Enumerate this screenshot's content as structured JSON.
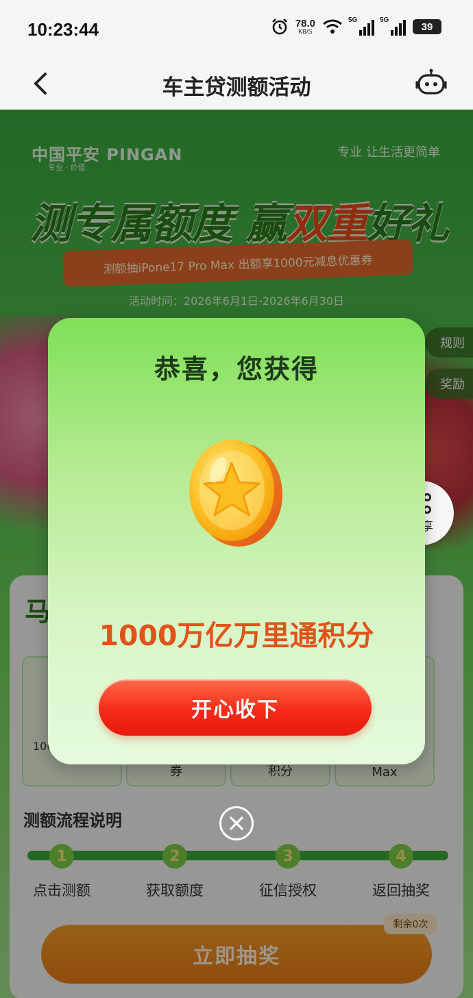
{
  "status_bar": {
    "time": "10:23:44",
    "net_speed_value": "78.0",
    "net_speed_unit": "KB/S",
    "signal1_label": "5G",
    "signal2_label": "5G",
    "battery": "39"
  },
  "nav": {
    "title": "车主贷测额活动",
    "icons": {
      "back": "chevron-left-icon",
      "service": "robot-service-icon"
    }
  },
  "background": {
    "brand": "中国平安 PINGAN",
    "brand_sub": "专业 · 价值",
    "slogan": "专业 让生活更简单",
    "headline_a": "测专属额度 赢",
    "headline_b": "双重",
    "headline_c": "好礼",
    "ribbon": "测额抽iPone17 Pro Max  出额享1000元减息优惠券",
    "period": "活动时间：2026年6月1日-2026年6月30日",
    "side_rule": "规则",
    "side_reward": "奖励",
    "card_head": "马",
    "prizes": [
      {
        "top": "100",
        "caption": ""
      },
      {
        "top": "",
        "caption": "券"
      },
      {
        "top": "",
        "caption": "积分"
      },
      {
        "top": "o",
        "caption": "Max"
      }
    ],
    "flow_title": "测额流程说明",
    "flow_steps": [
      {
        "num": "1",
        "label": "点击测额"
      },
      {
        "num": "2",
        "label": "获取额度"
      },
      {
        "num": "3",
        "label": "征信授权"
      },
      {
        "num": "4",
        "label": "返回抽奖"
      }
    ],
    "draw_button": "立即抽奖",
    "remaining": "剩余0次"
  },
  "share": {
    "label": "分享",
    "icon": "share-icon"
  },
  "modal": {
    "title": "恭喜，您获得",
    "coin_icon": "star-coin-icon",
    "reward_text": "1000万亿万里通积分",
    "accept_button": "开心收下"
  },
  "close_icon": "close-circle-icon",
  "colors": {
    "accent_orange": "#e0541a",
    "button_red": "#f42b18",
    "modal_green": "#7fe057"
  }
}
